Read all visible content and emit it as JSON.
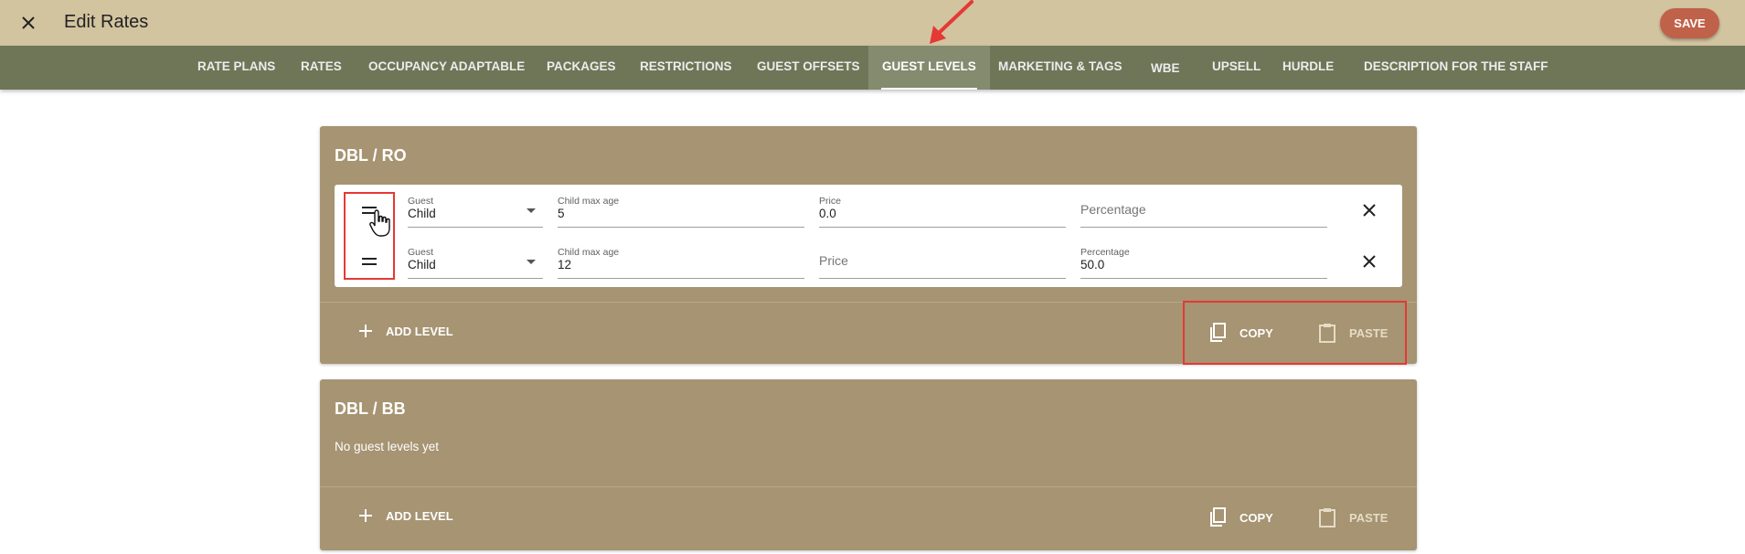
{
  "header": {
    "title": "Edit Rates",
    "save_label": "SAVE",
    "close_icon": "close-icon"
  },
  "tabs": [
    {
      "label": "RATE PLANS"
    },
    {
      "label": "RATES"
    },
    {
      "label": "OCCUPANCY ADAPTABLE"
    },
    {
      "label": "PACKAGES"
    },
    {
      "label": "RESTRICTIONS"
    },
    {
      "label": "GUEST OFFSETS"
    },
    {
      "label": "GUEST LEVELS",
      "active": true
    },
    {
      "label": "MARKETING & TAGS"
    },
    {
      "label": "WBE"
    },
    {
      "label": "UPSELL"
    },
    {
      "label": "HURDLE"
    },
    {
      "label": "DESCRIPTION FOR THE STAFF"
    }
  ],
  "cards": [
    {
      "title": "DBL / RO",
      "levels": [
        {
          "guest_label": "Guest",
          "guest_value": "Child",
          "age_label": "Child max age",
          "age_value": "5",
          "price_label": "Price",
          "price_value": "0.0",
          "pct_placeholder": "Percentage"
        },
        {
          "guest_label": "Guest",
          "guest_value": "Child",
          "age_label": "Child max age",
          "age_value": "12",
          "price_placeholder": "Price",
          "pct_label": "Percentage",
          "pct_value": "50.0"
        }
      ],
      "add_label": "ADD LEVEL",
      "copy_label": "COPY",
      "paste_label": "PASTE"
    },
    {
      "title": "DBL / BB",
      "empty_text": "No guest levels yet",
      "add_label": "ADD LEVEL",
      "copy_label": "COPY",
      "paste_label": "PASTE"
    }
  ],
  "colors": {
    "appbar": "#d3c4a0",
    "tabbar": "#6e7657",
    "card": "#a69472",
    "save": "#c0614a",
    "highlight": "#e53935"
  }
}
